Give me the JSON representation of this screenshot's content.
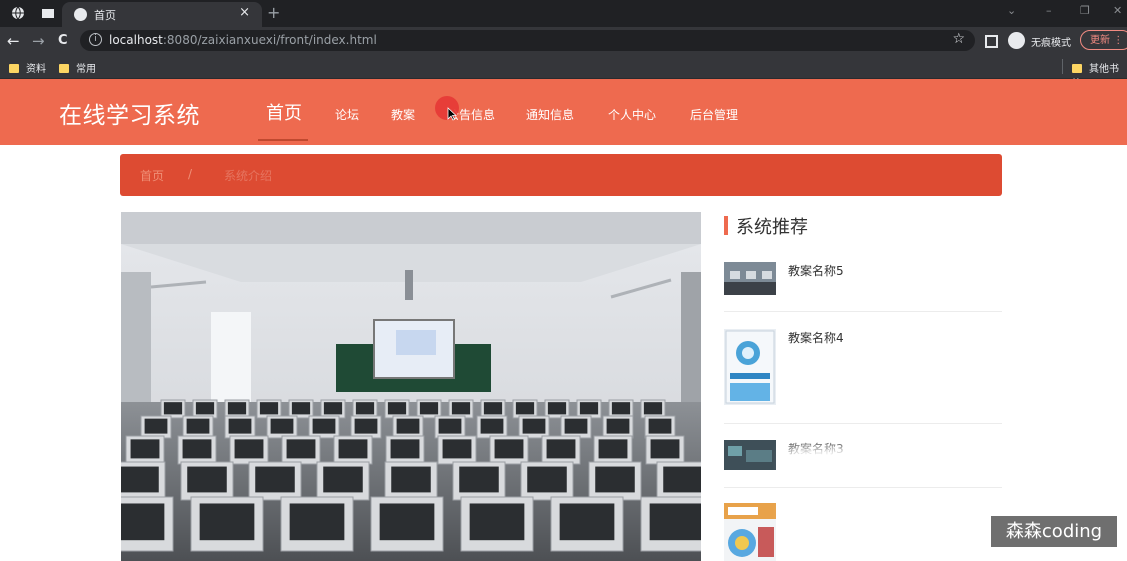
{
  "browser": {
    "tab_title": "首页",
    "tab_close": "×",
    "new_tab": "+",
    "window_controls": [
      "⌄",
      "–",
      "❐",
      "✕"
    ],
    "nav": {
      "back": "←",
      "forward": "→",
      "reload": "C"
    },
    "url_host": "localhost",
    "url_rest": ":8080/zaixianxuexi/front/index.html",
    "bookmark_star": "☆",
    "incognito_label": "无痕模式",
    "update_label": "更新",
    "menu_dots": "⋮",
    "bookmarks": [
      "资料",
      "常用"
    ],
    "other_bookmarks": "其他书签",
    "colors": {
      "tabstrip": "#202124",
      "toolbar": "#35363a",
      "update": "#f28b82"
    }
  },
  "site": {
    "title": "在线学习系统",
    "nav": [
      "首页",
      "论坛",
      "教案",
      "公告信息",
      "通知信息",
      "个人中心",
      "后台管理"
    ],
    "colors": {
      "header": "#ee6a4f",
      "breadcrumb": "#dd4b32"
    }
  },
  "breadcrumb": {
    "home": "首页",
    "separator": "/",
    "current": "系统介绍"
  },
  "sidebar": {
    "title": "系统推荐",
    "items": [
      {
        "name": "教案名称5"
      },
      {
        "name": "教案名称4"
      },
      {
        "name": "教案名称3"
      }
    ]
  },
  "watermark": "森森coding"
}
